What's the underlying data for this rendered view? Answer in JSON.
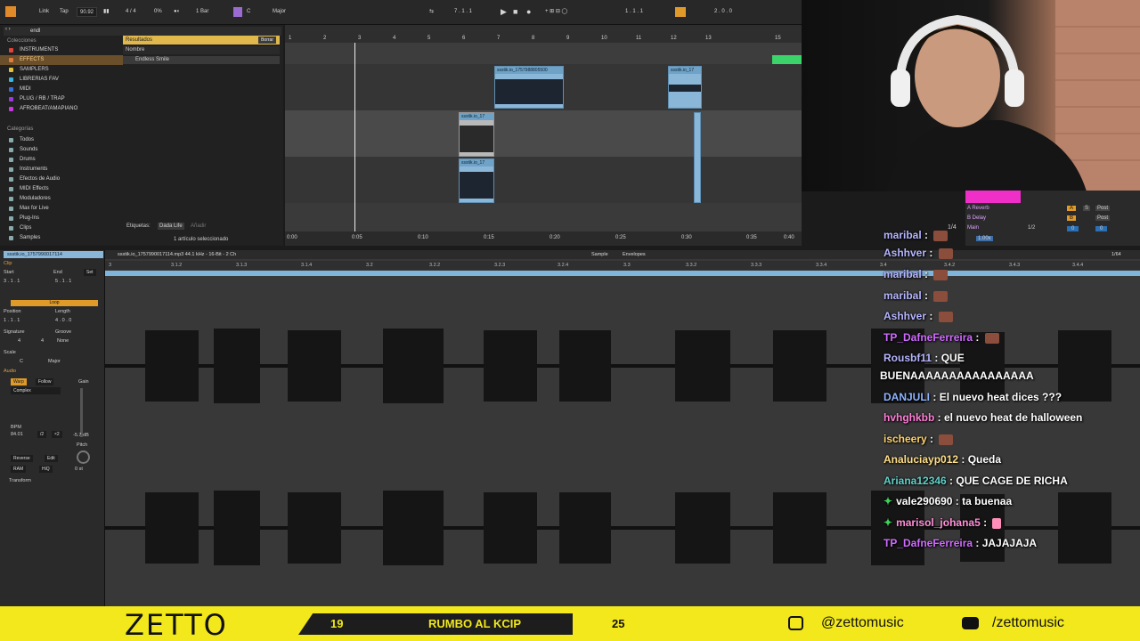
{
  "topbar": {
    "link": "Link",
    "tap": "Tap",
    "tempo": "90.92",
    "signature": "4 / 4",
    "cpu": "0%",
    "quantize": "1 Bar",
    "key": "C",
    "scale": "Major",
    "position": "7 . 1 . 1",
    "loop_start": "1 . 1 . 1",
    "loop_length": "2 . 0 . 0"
  },
  "browser": {
    "search_value": "endl",
    "collections_title": "Colecciones",
    "collections": [
      {
        "label": "INSTRUMENTS",
        "color": "#e0443a"
      },
      {
        "label": "EFFECTS",
        "color": "#e07b3a"
      },
      {
        "label": "SAMPLERS",
        "color": "#e0c23a"
      },
      {
        "label": "LIBRERIAS FAV",
        "color": "#3ab7e0"
      },
      {
        "label": "MIDI",
        "color": "#3a6fe0"
      },
      {
        "label": "PLUG / RB / TRAP",
        "color": "#9b3ae0"
      },
      {
        "label": "AFROBEAT/AMAPIANO",
        "color": "#c63ae0"
      }
    ],
    "categories_title": "Categorías",
    "categories": [
      "Todos",
      "Sounds",
      "Drums",
      "Instruments",
      "Efectos de Audio",
      "MIDI Effects",
      "Moduladores",
      "Max for Live",
      "Plug-Ins",
      "Clips",
      "Samples"
    ],
    "results_label": "Resultados",
    "clear_label": "Borrar",
    "name_header": "Nombre",
    "result_item": "Endless Smile",
    "tags_label": "Etiquetas:",
    "tag_value": "Dada Life",
    "add_label": "Añadir",
    "status": "1 artículo seleccionado"
  },
  "arrangement": {
    "bars": [
      "1",
      "2",
      "3",
      "4",
      "5",
      "6",
      "7",
      "8",
      "9",
      "10",
      "11",
      "12",
      "13",
      "15"
    ],
    "times": [
      "0:00",
      "0:05",
      "0:10",
      "0:15",
      "0:20",
      "0:25",
      "0:30",
      "0:35",
      "0:40"
    ],
    "clip_a": "ssstik.io_1757988805500",
    "clip_b": "ssstik.io_17",
    "clip_c": "ssstik.io_17",
    "clip_d": "ssstik.io_17"
  },
  "mixer": {
    "reverb": "A Reverb",
    "delay": "B Delay",
    "main": "Main",
    "fraction": "1/2",
    "quarter": "1/4",
    "tempo_mult": "1.00x",
    "post": "Post",
    "send_a": "A",
    "send_b": "B",
    "s": "S",
    "zero": "0"
  },
  "clipview": {
    "clip_name": "ssstik.io_1757990017114",
    "section_clip": "Clip",
    "start_label": "Start",
    "end_label": "End",
    "set_label": "Set",
    "start_value": "3 . 1 . 1",
    "end_value": "5 . 1 . 1",
    "loop_label": "Loop",
    "position_label": "Position",
    "length_label": "Length",
    "position_value": "1 . 1 . 1",
    "length_value": "4 . 0 . 0",
    "signature_label": "Signature",
    "groove_label": "Groove",
    "sig_num": "4",
    "sig_den": "4",
    "groove_value": "None",
    "scale_label": "Scale",
    "scale_key": "C",
    "scale_mode": "Major",
    "section_audio": "Audio",
    "warp": "Warp",
    "follow": "Follow",
    "warp_mode": "Complex",
    "gain_label": "Gain",
    "gain_value": "-5.7 dB",
    "bpm_label": "BPM",
    "bpm_value": "84.01",
    "half": "/2",
    "double": "×2",
    "pitch_label": "Pitch",
    "pitch_value": "0 st",
    "reverse": "Reverse",
    "edit": "Edit",
    "ram": "RAM",
    "hiq": "HiQ",
    "transform": "Transform"
  },
  "sampleview": {
    "file_info": "ssstik.io_1757990017114.mp3  44.1 kHz - 16-Bit - 2 Ch",
    "tab_sample": "Sample",
    "tab_envelopes": "Envelopes",
    "zoom": "1/64",
    "ruler": [
      "3",
      "3.1.2",
      "3.1.3",
      "3.1.4",
      "3.2",
      "3.2.2",
      "3.2.3",
      "3.2.4",
      "3.3",
      "3.3.2",
      "3.3.3",
      "3.3.4",
      "3.4",
      "3.4.2",
      "3.4.3",
      "3.4.4"
    ]
  },
  "chat": [
    {
      "user": "maribal",
      "color": "#b6b6ff",
      "text": "",
      "emote": true
    },
    {
      "user": "Ashhver",
      "color": "#b6b6ff",
      "text": "",
      "emote": true
    },
    {
      "user": "maribal",
      "color": "#b6b6ff",
      "text": "",
      "emote": true
    },
    {
      "user": "maribal",
      "color": "#b6b6ff",
      "text": "",
      "emote": true
    },
    {
      "user": "Ashhver",
      "color": "#b6b6ff",
      "text": "",
      "emote": true
    },
    {
      "user": "TP_DafneFerreira",
      "color": "#d06bff",
      "text": "",
      "emote": true
    },
    {
      "user": "Rousbf11",
      "color": "#b6b6ff",
      "text": "QUE",
      "emote": false
    },
    {
      "user": "",
      "color": "#ffffff",
      "text": "BUENAAAAAAAAAAAAAAAA",
      "emote": false
    },
    {
      "user": "DANJULI",
      "color": "#8fb4ff",
      "text": "El nuevo heat dices ???",
      "emote": false
    },
    {
      "user": "hvhghkbb",
      "color": "#ff7fd6",
      "text": "el nuevo heat de halloween",
      "emote": false
    },
    {
      "user": "ischeery",
      "color": "#ffd36b",
      "text": "",
      "emote": true
    },
    {
      "user": "Analuciayp012",
      "color": "#ffe08a",
      "text": "Queda",
      "emote": false
    },
    {
      "user": "Ariana12346",
      "color": "#5fd1c9",
      "text": "QUE CAGE DE RICHA",
      "emote": false
    },
    {
      "user": "vale290690",
      "color": "#ffffff",
      "text": "ta buenaa",
      "emote": false,
      "badge": true
    },
    {
      "user": "marisol_johana5",
      "color": "#ff8fd8",
      "text": "",
      "emote": true,
      "badge": true
    },
    {
      "user": "TP_DafneFerreira",
      "color": "#d06bff",
      "text": "JAJAJAJA",
      "emote": false
    }
  ],
  "footer": {
    "brand": "ZETTO",
    "prog_left": "19",
    "prog_label": "RUMBO AL KCIP",
    "prog_right": "25",
    "progress_fraction": 0.76,
    "instagram": "@zettomusic",
    "youtube": "/zettomusic"
  }
}
